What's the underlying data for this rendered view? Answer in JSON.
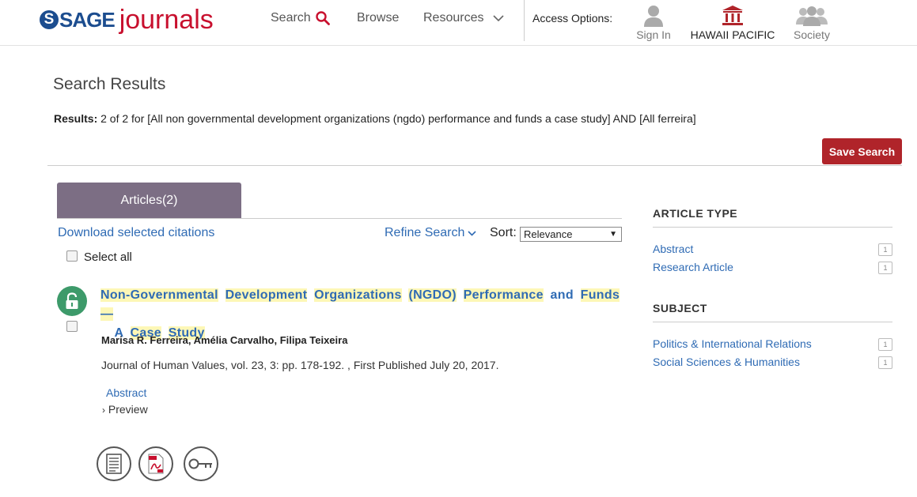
{
  "header": {
    "logo": {
      "mark": "S",
      "brand": "SAGE",
      "product": "journals"
    },
    "nav": {
      "search": "Search",
      "browse": "Browse",
      "resources": "Resources"
    },
    "access": {
      "label": "Access Options:",
      "sign_in": "Sign In",
      "institution": "HAWAII PACIFIC",
      "society": "Society"
    }
  },
  "results": {
    "title": "Search Results",
    "summary_label": "Results:",
    "summary_text": " 2 of 2 for [All non governmental development organizations (ngdo) performance and funds a case study] AND [All ferreira]",
    "save_search": "Save Search"
  },
  "tabs": {
    "articles": "Articles(2)"
  },
  "toolbar": {
    "download": "Download selected citations",
    "refine": "Refine Search",
    "sort_label": "Sort:",
    "sort_value": "Relevance",
    "select_all": "Select all"
  },
  "items": [
    {
      "title_words": [
        "Non-Governmental",
        "Development",
        "Organizations",
        "(NGDO)",
        "Performance",
        "and",
        "Funds—",
        "A",
        "Case",
        "Study"
      ],
      "authors": [
        "Marisa R. Ferreira",
        "Amélia Carvalho",
        "Filipa Teixeira"
      ],
      "citation": "Journal of Human Values, vol. 23, 3: pp. 178-192. , First Published July 20, 2017.",
      "abstract": "Abstract",
      "preview": "Preview",
      "icons": [
        "full-text-icon",
        "pdf-icon",
        "permissions-key-icon"
      ]
    }
  ],
  "facets": {
    "article_type": {
      "heading": "ARTICLE TYPE",
      "items": [
        {
          "label": "Abstract",
          "count": "1"
        },
        {
          "label": "Research Article",
          "count": "1"
        }
      ]
    },
    "subject": {
      "heading": "SUBJECT",
      "items": [
        {
          "label": "Politics & International Relations",
          "count": "1"
        },
        {
          "label": "Social Sciences & Humanities",
          "count": "1"
        }
      ]
    }
  },
  "colors": {
    "brand_blue": "#1c4d8f",
    "brand_red": "#c8102e",
    "link": "#2f6bb4",
    "tab": "#7c6e84",
    "save_button": "#b0242a",
    "open_access": "#3d9a6a",
    "highlight": "#fdf7b6"
  }
}
